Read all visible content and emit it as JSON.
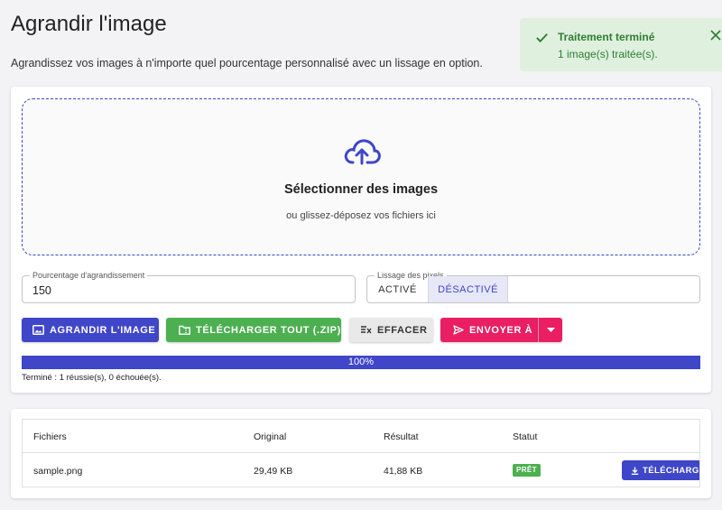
{
  "header": {
    "title": "Agrandir l'image",
    "subtitle": "Agrandissez vos images à n'importe quel pourcentage personnalisé avec un lissage en option."
  },
  "toast": {
    "title": "Traitement terminé",
    "message": "1 image(s) traitée(s).",
    "check_icon": "check-icon",
    "close_icon": "close-icon",
    "color": "#2e7d32"
  },
  "dropzone": {
    "icon": "cloud-upload-icon",
    "title": "Sélectionner des images",
    "subtitle": "ou glissez-déposez vos fichiers ici"
  },
  "percentage": {
    "label": "Pourcentage d'agrandissement",
    "value": "150"
  },
  "smoothing": {
    "label": "Lissage des pixels",
    "options": [
      "ACTIVÉ",
      "DÉSACTIVÉ"
    ],
    "selected": "DÉSACTIVÉ"
  },
  "toolbar": {
    "enlarge_label": "AGRANDIR L'IMAGE",
    "zip_label": "TÉLÉCHARGER TOUT (.ZIP)",
    "clear_label": "EFFACER",
    "send_label": "ENVOYER À"
  },
  "progress": {
    "value": 1.0,
    "label": "100%",
    "summary": "Terminé : 1 réussie(s), 0 échouée(s)."
  },
  "table": {
    "headers": [
      "Fichiers",
      "Original",
      "Résultat",
      "Statut"
    ],
    "rows": [
      {
        "file": "sample.png",
        "original": "29,49 KB",
        "result": "41,88 KB",
        "status": "PRÊT",
        "action": "TÉLÉCHARGER"
      }
    ]
  },
  "colors": {
    "primary": "#3f46c8",
    "success": "#4caf50",
    "accent": "#e91e63"
  }
}
